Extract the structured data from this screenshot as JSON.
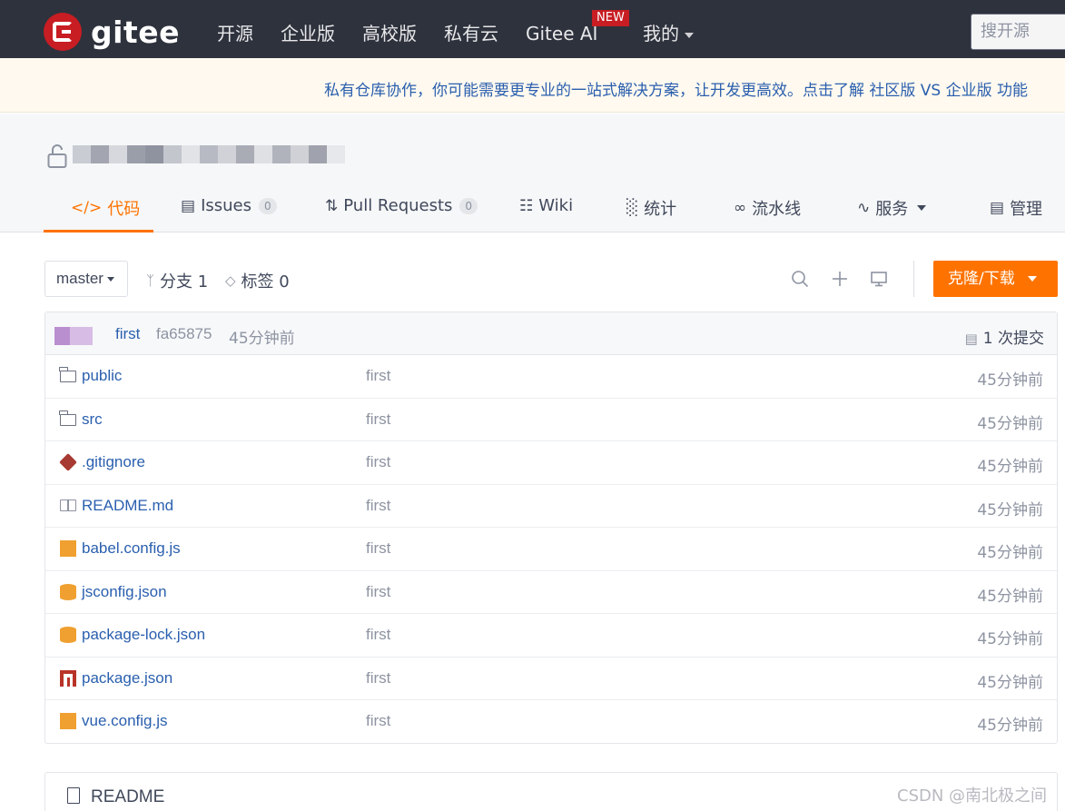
{
  "topnav": {
    "brand": "gitee",
    "items": [
      "开源",
      "企业版",
      "高校版",
      "私有云",
      "Gitee AI",
      "我的"
    ],
    "new_badge": "NEW",
    "search_placeholder": "搜开源"
  },
  "banner": {
    "text": "私有仓库协作，你可能需要更专业的一站式解决方案，让开发更高效。点击了解 社区版 VS 企业版 功能"
  },
  "tabs": [
    {
      "label": "代码",
      "icon": "code-icon"
    },
    {
      "label": "Issues",
      "count": "0",
      "icon": "issues-icon"
    },
    {
      "label": "Pull Requests",
      "count": "0",
      "icon": "pull-request-icon"
    },
    {
      "label": "Wiki",
      "icon": "wiki-icon"
    },
    {
      "label": "统计",
      "icon": "stats-icon"
    },
    {
      "label": "流水线",
      "icon": "pipeline-icon"
    },
    {
      "label": "服务",
      "icon": "service-icon"
    },
    {
      "label": "管理",
      "icon": "manage-icon"
    }
  ],
  "toolbar": {
    "branch": "master",
    "branches": "分支 1",
    "tags": "标签 0",
    "clone_label": "克隆/下载"
  },
  "commit": {
    "message": "first",
    "sha": "fa65875",
    "time": "45分钟前",
    "count": "1 次提交"
  },
  "files": [
    {
      "name": "public",
      "type": "folder",
      "commit": "first",
      "time": "45分钟前"
    },
    {
      "name": "src",
      "type": "folder",
      "commit": "first",
      "time": "45分钟前"
    },
    {
      "name": ".gitignore",
      "type": "git",
      "commit": "first",
      "time": "45分钟前"
    },
    {
      "name": "README.md",
      "type": "readme",
      "commit": "first",
      "time": "45分钟前"
    },
    {
      "name": "babel.config.js",
      "type": "js",
      "commit": "first",
      "time": "45分钟前"
    },
    {
      "name": "jsconfig.json",
      "type": "json",
      "commit": "first",
      "time": "45分钟前"
    },
    {
      "name": "package-lock.json",
      "type": "json",
      "commit": "first",
      "time": "45分钟前"
    },
    {
      "name": "package.json",
      "type": "npm",
      "commit": "first",
      "time": "45分钟前"
    },
    {
      "name": "vue.config.js",
      "type": "js",
      "commit": "first",
      "time": "45分钟前"
    }
  ],
  "readme": {
    "title": "README"
  },
  "watermark": "CSDN @南北极之间",
  "colors": {
    "nav_bg": "#2e323d",
    "accent": "#fe7300",
    "link": "#2a5fae",
    "brand_red": "#c71d23"
  }
}
